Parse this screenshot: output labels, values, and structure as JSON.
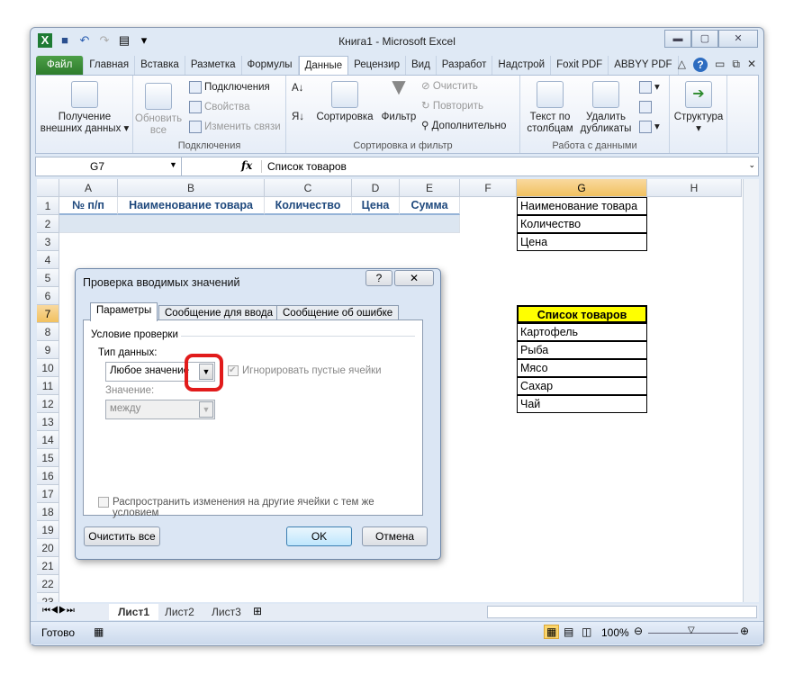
{
  "window": {
    "title": "Книга1  -  Microsoft Excel"
  },
  "tabs": [
    "Файл",
    "Главная",
    "Вставка",
    "Разметка",
    "Формулы",
    "Данные",
    "Рецензир",
    "Вид",
    "Разработ",
    "Надстрой",
    "Foxit PDF",
    "ABBYY PDF"
  ],
  "active_tab": "Данные",
  "ribbon": {
    "get_external": "Получение внешних данных",
    "refresh_all": "Обновить все",
    "connections": "Подключения",
    "properties": "Свойства",
    "edit_links": "Изменить связи",
    "group_connections": "Подключения",
    "sort": "Сортировка",
    "filter": "Фильтр",
    "clear": "Очистить",
    "reapply": "Повторить",
    "advanced": "Дополнительно",
    "group_sort": "Сортировка и фильтр",
    "text_to_columns": "Текст по столбцам",
    "remove_duplicates": "Удалить дубликаты",
    "group_data": "Работа с данными",
    "outline": "Структура"
  },
  "formula_bar": {
    "name_box": "G7",
    "fx": "fx",
    "value": "Список товаров"
  },
  "columns": [
    "A",
    "B",
    "C",
    "D",
    "E",
    "F",
    "G",
    "H"
  ],
  "selected_column": "G",
  "selected_row": 7,
  "rows": 23,
  "cells": [
    {
      "ref": "A1",
      "v": "№ п/п"
    },
    {
      "ref": "B1",
      "v": "Наименование товара"
    },
    {
      "ref": "C1",
      "v": "Количество"
    },
    {
      "ref": "D1",
      "v": "Цена"
    },
    {
      "ref": "E1",
      "v": "Сумма"
    },
    {
      "ref": "G1",
      "v": "Наименование товара"
    },
    {
      "ref": "G2",
      "v": "Количество"
    },
    {
      "ref": "G3",
      "v": "Цена"
    },
    {
      "ref": "G7",
      "v": "Список товаров"
    },
    {
      "ref": "G8",
      "v": "Картофель"
    },
    {
      "ref": "G9",
      "v": "Рыба"
    },
    {
      "ref": "G10",
      "v": "Мясо"
    },
    {
      "ref": "G11",
      "v": "Сахар"
    },
    {
      "ref": "G12",
      "v": "Чай"
    }
  ],
  "colors": {
    "header_text": "#1f497d",
    "highlight": "#ffff00",
    "table_fill": "#dce6f1"
  },
  "sheets": [
    "Лист1",
    "Лист2",
    "Лист3"
  ],
  "active_sheet": "Лист1",
  "status": {
    "ready": "Готово",
    "zoom": "100%",
    "zoom_level": 100
  },
  "dialog": {
    "title": "Проверка вводимых значений",
    "help": "?",
    "close": "✕",
    "tabs": [
      "Параметры",
      "Сообщение для ввода",
      "Сообщение об ошибке"
    ],
    "section": "Условие проверки",
    "data_type_label": "Тип данных:",
    "data_type_value": "Любое значение",
    "ignore_blank": "Игнорировать пустые ячейки",
    "ignore_blank_checked": true,
    "value_label": "Значение:",
    "value_value": "между",
    "apply_all": "Распространить изменения на другие ячейки с тем же условием",
    "clear_all": "Очистить все",
    "ok": "OK",
    "cancel": "Отмена"
  }
}
